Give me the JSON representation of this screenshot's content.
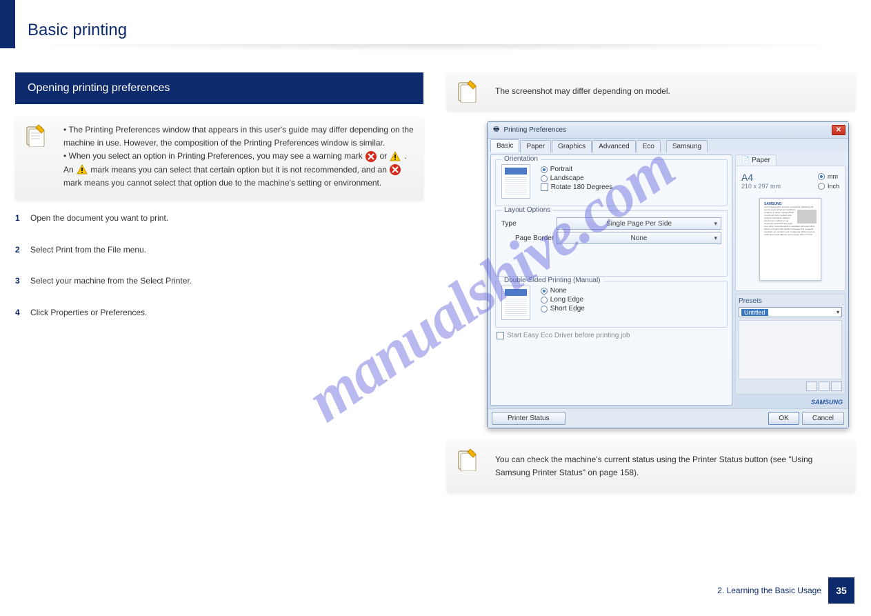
{
  "page": {
    "title": "Basic printing",
    "number": "35",
    "footer": "2.  Learning the Basic Usage"
  },
  "watermark": "manualshive.com",
  "left": {
    "section_title": "Opening printing preferences",
    "note1_p1": "The Printing Preferences window that appears in this user's guide may differ depending on the machine in use. However, the composition of the Printing Preferences window is similar.",
    "note1_p2_a": "When you select an option in Printing Preferences, you may see a warning mark ",
    "note1_p2_b": " or ",
    "note1_p2_c": ". An ",
    "note1_p2_d": " mark means you can select that certain option but it is not recommended, and an ",
    "note1_p2_e": " mark means you cannot select that option due to the machine's setting or environment.",
    "step1": "Open the document you want to print.",
    "step2_a": "Select Print from the File menu.",
    "step3": "Select your machine from the Select Printer.",
    "step4": "Click Properties or Preferences."
  },
  "right": {
    "note_top": "The screenshot may differ depending on model.",
    "note_bottom": "You can check the machine's current status using the Printer Status button (see \"Using Samsung Printer Status\" on page 158)."
  },
  "dialog": {
    "title": "Printing Preferences",
    "tabs": [
      "Basic",
      "Paper",
      "Graphics",
      "Advanced",
      "Eco",
      "Samsung"
    ],
    "orientation": {
      "legend": "Orientation",
      "portrait": "Portrait",
      "landscape": "Landscape",
      "rotate": "Rotate 180 Degrees"
    },
    "layout": {
      "legend": "Layout Options",
      "type_label": "Type",
      "type_value": "Single Page Per Side",
      "border_label": "Page Border",
      "border_value": "None"
    },
    "duplex": {
      "legend": "Double-Sided Printing (Manual)",
      "none": "None",
      "long": "Long Edge",
      "short": "Short Edge"
    },
    "eco_check": "Start Easy Eco Driver before printing job",
    "paper": {
      "tab": "Paper",
      "size": "A4",
      "dims": "210 x 297 mm",
      "mm": "mm",
      "inch": "Inch"
    },
    "presets": {
      "title": "Presets",
      "value": "Untitled"
    },
    "samsung": "SAMSUNG",
    "footer": {
      "status": "Printer Status",
      "ok": "OK",
      "cancel": "Cancel"
    }
  }
}
